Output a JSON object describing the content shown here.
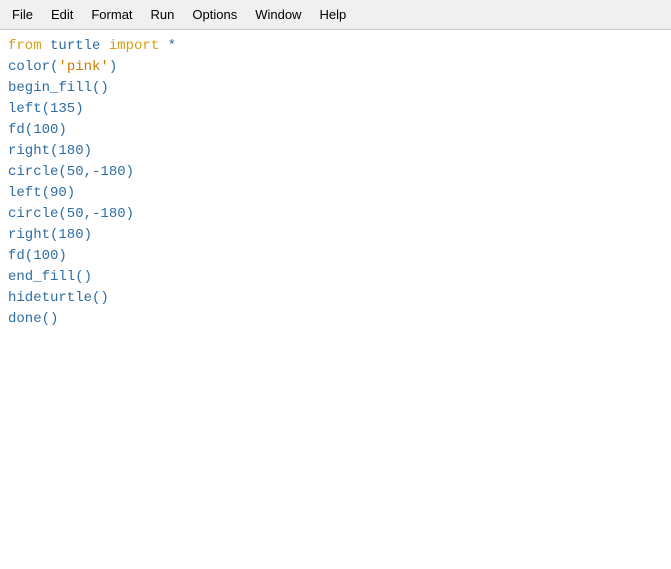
{
  "menubar": {
    "items": [
      {
        "id": "file",
        "label": "File"
      },
      {
        "id": "edit",
        "label": "Edit"
      },
      {
        "id": "format",
        "label": "Format"
      },
      {
        "id": "run",
        "label": "Run"
      },
      {
        "id": "options",
        "label": "Options"
      },
      {
        "id": "window",
        "label": "Window"
      },
      {
        "id": "help",
        "label": "Help"
      }
    ]
  },
  "code": {
    "lines": [
      "from turtle import *",
      "color('pink')",
      "begin_fill()",
      "left(135)",
      "fd(100)",
      "right(180)",
      "circle(50,-180)",
      "left(90)",
      "circle(50,-180)",
      "right(180)",
      "fd(100)",
      "end_fill()",
      "hideturtle()",
      "done()"
    ]
  }
}
